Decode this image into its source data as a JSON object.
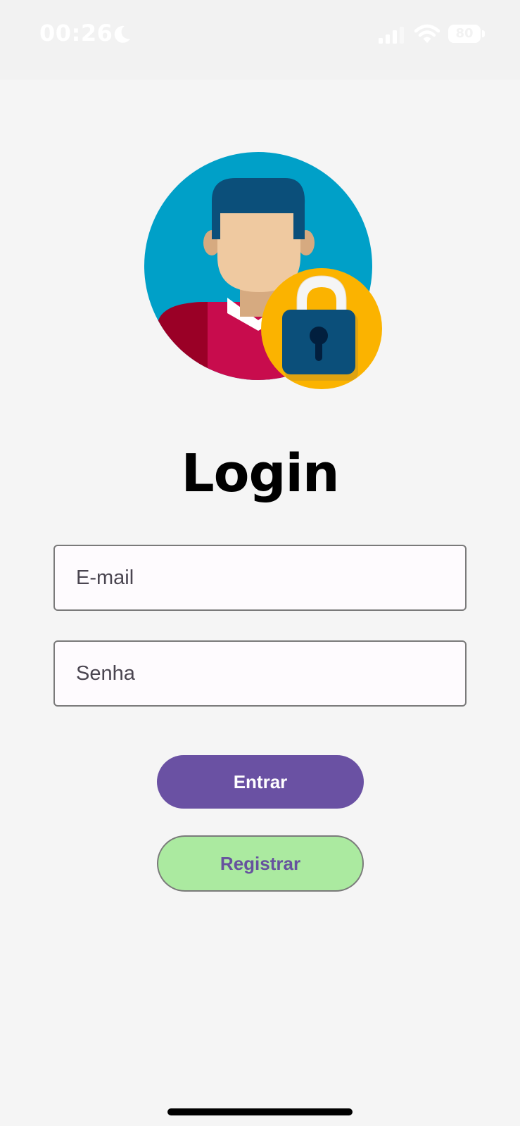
{
  "status_bar": {
    "time": "00:26",
    "battery_level": "80",
    "icons": [
      "moon-icon",
      "signal-icon",
      "wifi-icon",
      "battery-icon"
    ]
  },
  "login": {
    "title": "Login",
    "email_placeholder": "E-mail",
    "password_placeholder": "Senha",
    "login_button_label": "Entrar",
    "register_button_label": "Registrar"
  },
  "colors": {
    "background": "#f5f5f5",
    "primary_button": "#6a51a3",
    "secondary_button": "#abeaa0",
    "secondary_button_text": "#66529e",
    "avatar_circle": "#00a0c8",
    "lock_badge": "#fbb300"
  }
}
